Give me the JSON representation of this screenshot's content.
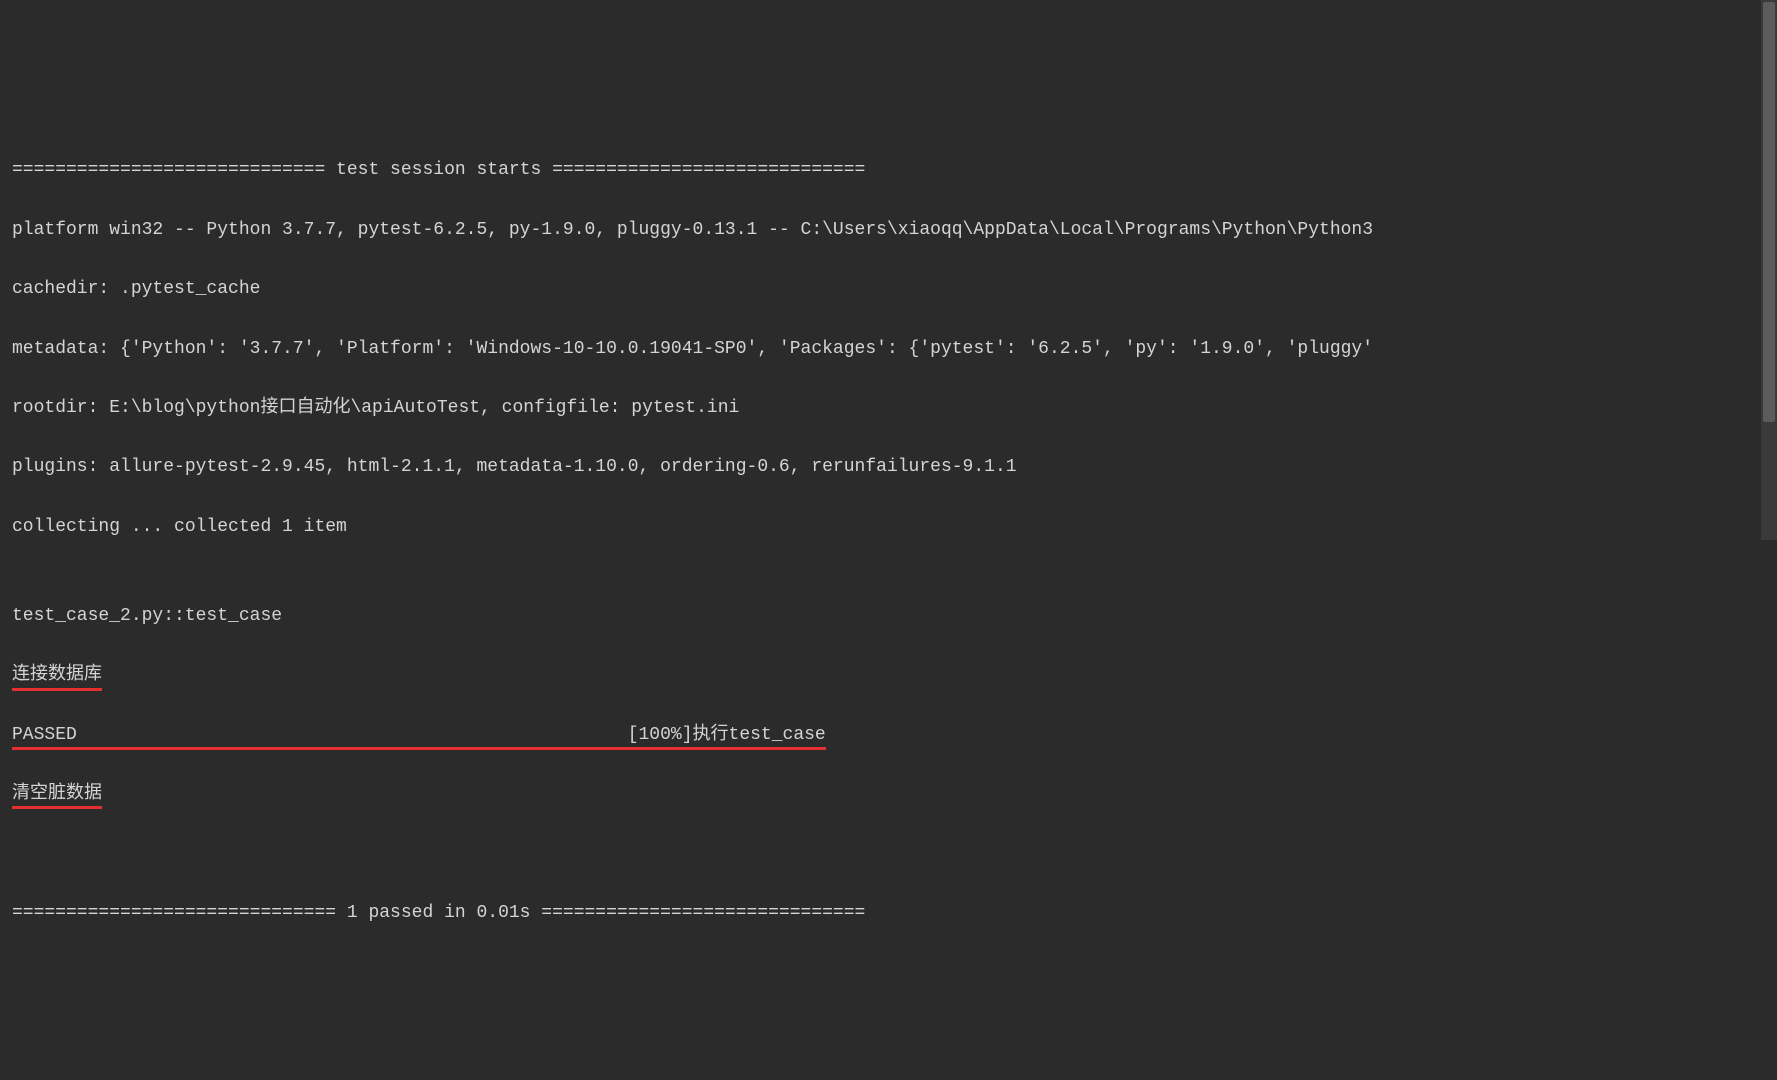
{
  "session_header": "============================= test session starts =============================",
  "platform_line": "platform win32 -- Python 3.7.7, pytest-6.2.5, py-1.9.0, pluggy-0.13.1 -- C:\\Users\\xiaoqq\\AppData\\Local\\Programs\\Python\\Python3",
  "cachedir_line": "cachedir: .pytest_cache",
  "metadata_line": "metadata: {'Python': '3.7.7', 'Platform': 'Windows-10-10.0.19041-SP0', 'Packages': {'pytest': '6.2.5', 'py': '1.9.0', 'pluggy'",
  "rootdir_line": "rootdir: E:\\blog\\python接口自动化\\apiAutoTest, configfile: pytest.ini",
  "plugins_line": "plugins: allure-pytest-2.9.45, html-2.1.1, metadata-1.10.0, ordering-0.6, rerunfailures-9.1.1",
  "collecting_line": "collecting ... collected 1 item",
  "blank": "",
  "test_name_line": "test_case_2.py::test_case ",
  "connect_db_text": "连接数据库",
  "passed_prefix": "PASSED                                                   [100%]",
  "passed_suffix": "执行test_case",
  "clear_data_text": "清空脏数据",
  "footer_line": "============================== 1 passed in 0.01s =============================="
}
